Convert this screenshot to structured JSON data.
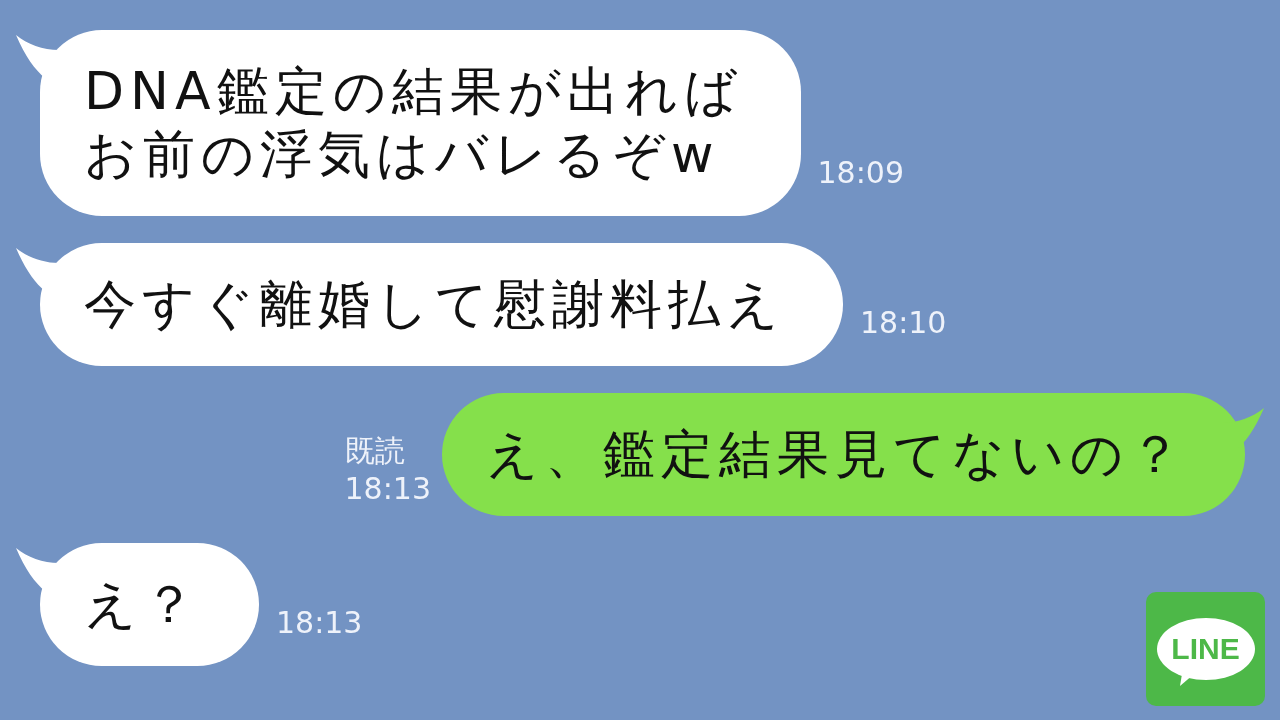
{
  "messages": [
    {
      "kind": "incoming",
      "lines": [
        "DNA鑑定の結果が出れば",
        "お前の浮気はバレるぞw"
      ],
      "time": "18:09"
    },
    {
      "kind": "incoming",
      "lines": [
        "今すぐ離婚して慰謝料払え"
      ],
      "time": "18:10"
    },
    {
      "kind": "outgoing",
      "lines": [
        "え、鑑定結果見てないの？"
      ],
      "read": "既読",
      "time": "18:13"
    },
    {
      "kind": "incoming",
      "lines": [
        "え？"
      ],
      "time": "18:13"
    }
  ],
  "logo": {
    "text": "LINE"
  }
}
